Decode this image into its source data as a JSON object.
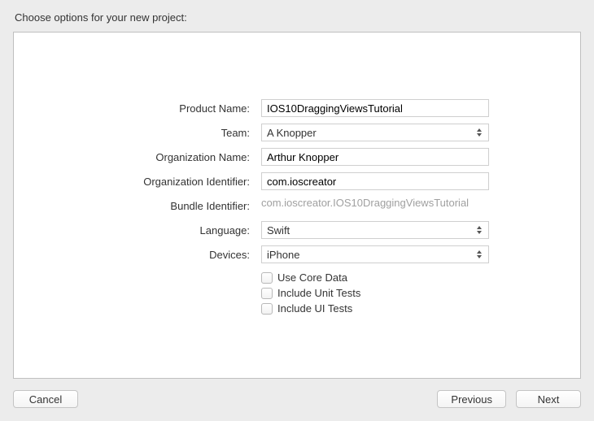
{
  "heading": "Choose options for your new project:",
  "labels": {
    "product_name": "Product Name:",
    "team": "Team:",
    "organization_name": "Organization Name:",
    "organization_identifier": "Organization Identifier:",
    "bundle_identifier": "Bundle Identifier:",
    "language": "Language:",
    "devices": "Devices:"
  },
  "values": {
    "product_name": "IOS10DraggingViewsTutorial",
    "team": "A Knopper",
    "organization_name": "Arthur Knopper",
    "organization_identifier": "com.ioscreator",
    "bundle_identifier": "com.ioscreator.IOS10DraggingViewsTutorial",
    "language": "Swift",
    "devices": "iPhone"
  },
  "checkboxes": {
    "use_core_data": "Use Core Data",
    "include_unit_tests": "Include Unit Tests",
    "include_ui_tests": "Include UI Tests"
  },
  "buttons": {
    "cancel": "Cancel",
    "previous": "Previous",
    "next": "Next"
  }
}
